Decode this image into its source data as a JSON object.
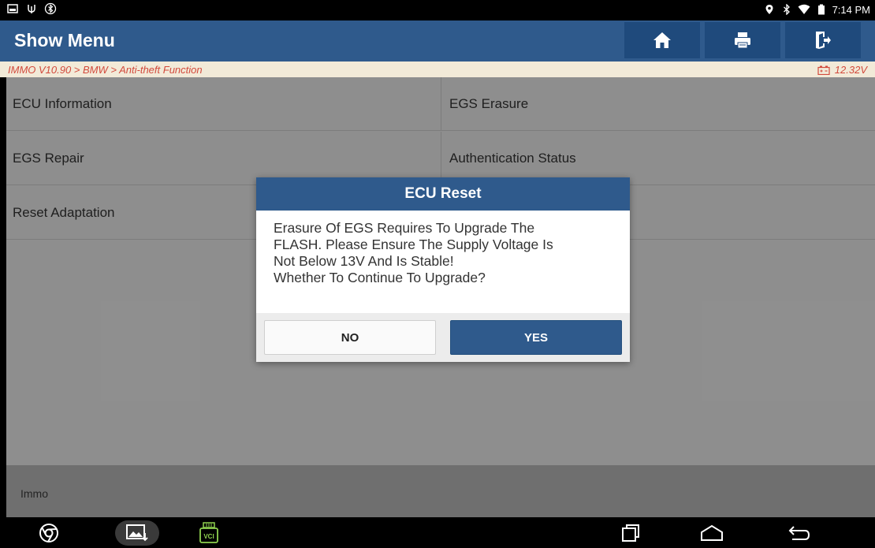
{
  "status_bar": {
    "time": "7:14 PM"
  },
  "title_bar": {
    "title": "Show Menu"
  },
  "breadcrumb": {
    "path": "IMMO V10.90 > BMW > Anti-theft Function",
    "voltage": "12.32V"
  },
  "menu": {
    "items": [
      {
        "label": "ECU Information"
      },
      {
        "label": "EGS Erasure"
      },
      {
        "label": "EGS Repair"
      },
      {
        "label": "Authentication Status"
      },
      {
        "label": "Reset Adaptation"
      }
    ]
  },
  "footer": {
    "label": "Immo"
  },
  "dialog": {
    "title": "ECU Reset",
    "message": "Erasure Of EGS Requires To Upgrade The\nFLASH. Please Ensure The Supply Voltage Is\nNot Below 13V And Is Stable!\nWhether To Continue To Upgrade?",
    "no_label": "NO",
    "yes_label": "YES"
  },
  "nav_bar": {
    "vci_label": "VCI"
  },
  "colors": {
    "primary_blue": "#2f5a8c",
    "breadcrumb_text": "#d24a3c",
    "breadcrumb_bg": "#f2ead8"
  }
}
